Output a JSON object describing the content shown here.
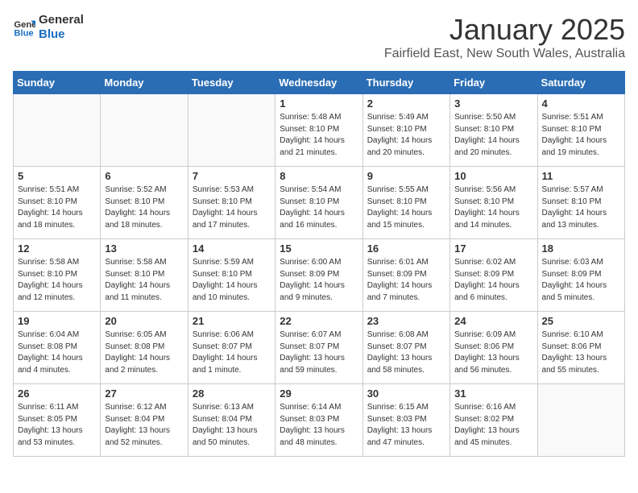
{
  "logo": {
    "line1": "General",
    "line2": "Blue"
  },
  "title": "January 2025",
  "subtitle": "Fairfield East, New South Wales, Australia",
  "weekdays": [
    "Sunday",
    "Monday",
    "Tuesday",
    "Wednesday",
    "Thursday",
    "Friday",
    "Saturday"
  ],
  "weeks": [
    [
      {
        "day": "",
        "info": ""
      },
      {
        "day": "",
        "info": ""
      },
      {
        "day": "",
        "info": ""
      },
      {
        "day": "1",
        "info": "Sunrise: 5:48 AM\nSunset: 8:10 PM\nDaylight: 14 hours\nand 21 minutes."
      },
      {
        "day": "2",
        "info": "Sunrise: 5:49 AM\nSunset: 8:10 PM\nDaylight: 14 hours\nand 20 minutes."
      },
      {
        "day": "3",
        "info": "Sunrise: 5:50 AM\nSunset: 8:10 PM\nDaylight: 14 hours\nand 20 minutes."
      },
      {
        "day": "4",
        "info": "Sunrise: 5:51 AM\nSunset: 8:10 PM\nDaylight: 14 hours\nand 19 minutes."
      }
    ],
    [
      {
        "day": "5",
        "info": "Sunrise: 5:51 AM\nSunset: 8:10 PM\nDaylight: 14 hours\nand 18 minutes."
      },
      {
        "day": "6",
        "info": "Sunrise: 5:52 AM\nSunset: 8:10 PM\nDaylight: 14 hours\nand 18 minutes."
      },
      {
        "day": "7",
        "info": "Sunrise: 5:53 AM\nSunset: 8:10 PM\nDaylight: 14 hours\nand 17 minutes."
      },
      {
        "day": "8",
        "info": "Sunrise: 5:54 AM\nSunset: 8:10 PM\nDaylight: 14 hours\nand 16 minutes."
      },
      {
        "day": "9",
        "info": "Sunrise: 5:55 AM\nSunset: 8:10 PM\nDaylight: 14 hours\nand 15 minutes."
      },
      {
        "day": "10",
        "info": "Sunrise: 5:56 AM\nSunset: 8:10 PM\nDaylight: 14 hours\nand 14 minutes."
      },
      {
        "day": "11",
        "info": "Sunrise: 5:57 AM\nSunset: 8:10 PM\nDaylight: 14 hours\nand 13 minutes."
      }
    ],
    [
      {
        "day": "12",
        "info": "Sunrise: 5:58 AM\nSunset: 8:10 PM\nDaylight: 14 hours\nand 12 minutes."
      },
      {
        "day": "13",
        "info": "Sunrise: 5:58 AM\nSunset: 8:10 PM\nDaylight: 14 hours\nand 11 minutes."
      },
      {
        "day": "14",
        "info": "Sunrise: 5:59 AM\nSunset: 8:10 PM\nDaylight: 14 hours\nand 10 minutes."
      },
      {
        "day": "15",
        "info": "Sunrise: 6:00 AM\nSunset: 8:09 PM\nDaylight: 14 hours\nand 9 minutes."
      },
      {
        "day": "16",
        "info": "Sunrise: 6:01 AM\nSunset: 8:09 PM\nDaylight: 14 hours\nand 7 minutes."
      },
      {
        "day": "17",
        "info": "Sunrise: 6:02 AM\nSunset: 8:09 PM\nDaylight: 14 hours\nand 6 minutes."
      },
      {
        "day": "18",
        "info": "Sunrise: 6:03 AM\nSunset: 8:09 PM\nDaylight: 14 hours\nand 5 minutes."
      }
    ],
    [
      {
        "day": "19",
        "info": "Sunrise: 6:04 AM\nSunset: 8:08 PM\nDaylight: 14 hours\nand 4 minutes."
      },
      {
        "day": "20",
        "info": "Sunrise: 6:05 AM\nSunset: 8:08 PM\nDaylight: 14 hours\nand 2 minutes."
      },
      {
        "day": "21",
        "info": "Sunrise: 6:06 AM\nSunset: 8:07 PM\nDaylight: 14 hours\nand 1 minute."
      },
      {
        "day": "22",
        "info": "Sunrise: 6:07 AM\nSunset: 8:07 PM\nDaylight: 13 hours\nand 59 minutes."
      },
      {
        "day": "23",
        "info": "Sunrise: 6:08 AM\nSunset: 8:07 PM\nDaylight: 13 hours\nand 58 minutes."
      },
      {
        "day": "24",
        "info": "Sunrise: 6:09 AM\nSunset: 8:06 PM\nDaylight: 13 hours\nand 56 minutes."
      },
      {
        "day": "25",
        "info": "Sunrise: 6:10 AM\nSunset: 8:06 PM\nDaylight: 13 hours\nand 55 minutes."
      }
    ],
    [
      {
        "day": "26",
        "info": "Sunrise: 6:11 AM\nSunset: 8:05 PM\nDaylight: 13 hours\nand 53 minutes."
      },
      {
        "day": "27",
        "info": "Sunrise: 6:12 AM\nSunset: 8:04 PM\nDaylight: 13 hours\nand 52 minutes."
      },
      {
        "day": "28",
        "info": "Sunrise: 6:13 AM\nSunset: 8:04 PM\nDaylight: 13 hours\nand 50 minutes."
      },
      {
        "day": "29",
        "info": "Sunrise: 6:14 AM\nSunset: 8:03 PM\nDaylight: 13 hours\nand 48 minutes."
      },
      {
        "day": "30",
        "info": "Sunrise: 6:15 AM\nSunset: 8:03 PM\nDaylight: 13 hours\nand 47 minutes."
      },
      {
        "day": "31",
        "info": "Sunrise: 6:16 AM\nSunset: 8:02 PM\nDaylight: 13 hours\nand 45 minutes."
      },
      {
        "day": "",
        "info": ""
      }
    ]
  ]
}
